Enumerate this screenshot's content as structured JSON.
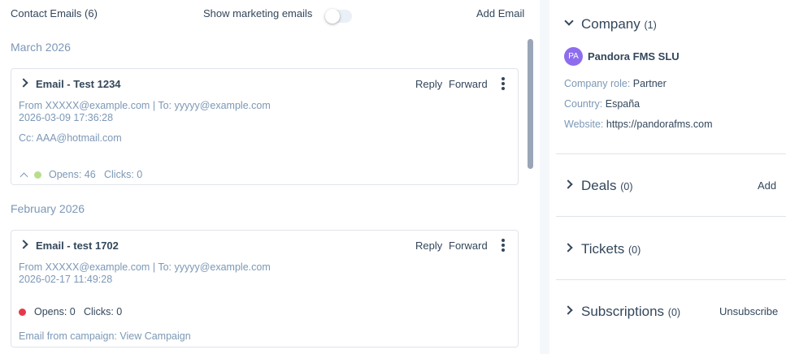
{
  "header": {
    "title": "Contact Emails (6)",
    "marketing_label": "Show marketing emails",
    "add_email": "Add Email"
  },
  "groups": [
    {
      "month": "March 2026",
      "email": {
        "subject": "Email - Test 1234",
        "reply": "Reply",
        "forward": "Forward",
        "from_to": "From XXXXX@example.com | To: yyyyy@example.com",
        "datetime": "2026-03-09 17:36:28",
        "cc": "Cc: AAA@hotmail.com",
        "status_color": "#b8dd8f",
        "opens": "Opens: 46",
        "clicks": "Clicks: 0"
      }
    },
    {
      "month": "February 2026",
      "email": {
        "subject": "Email - test 1702",
        "reply": "Reply",
        "forward": "Forward",
        "from_to": "From XXXXX@example.com | To: yyyyy@example.com",
        "datetime": "2026-02-17 11:49:28",
        "status_color": "#e5394b",
        "opens": "Opens: 0",
        "clicks": "Clicks: 0",
        "campaign": "Email from campaign: View Campaign"
      }
    }
  ],
  "sidebar": {
    "company": {
      "title": "Company",
      "count": "(1)",
      "avatar": "PA",
      "avatar_color": "#8d6dee",
      "name": "Pandora FMS SLU",
      "role_key": "Company role:",
      "role_val": "Partner",
      "country_key": "Country:",
      "country_val": "España",
      "website_key": "Website:",
      "website_val": "https://pandorafms.com"
    },
    "deals": {
      "title": "Deals",
      "count": "(0)",
      "action": "Add"
    },
    "tickets": {
      "title": "Tickets",
      "count": "(0)"
    },
    "subscriptions": {
      "title": "Subscriptions",
      "count": "(0)",
      "action": "Unsubscribe"
    }
  }
}
